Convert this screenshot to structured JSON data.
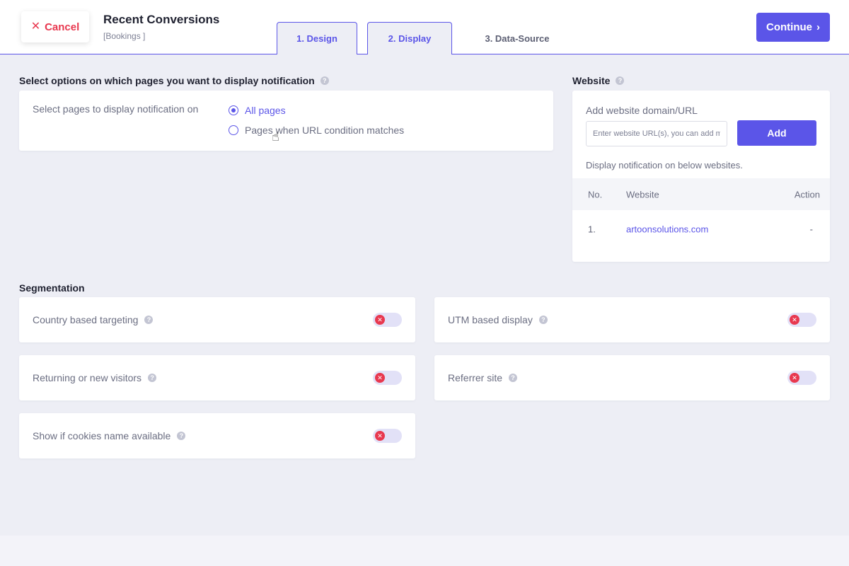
{
  "header": {
    "cancel_label": "Cancel",
    "title": "Recent Conversions",
    "subtitle": "[Bookings ]",
    "tabs": [
      {
        "label": "1. Design"
      },
      {
        "label": "2. Display"
      },
      {
        "label": "3. Data-Source"
      }
    ],
    "continue_label": "Continue",
    "accent_color": "#5b55e8",
    "cancel_color": "#e8384f"
  },
  "display_pages": {
    "heading": "Select options on which pages you want to display notification",
    "field_label": "Select pages to display notification on",
    "options": [
      {
        "label": "All pages",
        "selected": true
      },
      {
        "label": "Pages when URL condition matches",
        "selected": false
      }
    ]
  },
  "website": {
    "heading": "Website",
    "field_label": "Add website domain/URL",
    "input_placeholder": "Enter website URL(s), you can add multiple",
    "add_label": "Add",
    "note": "Display notification on below websites.",
    "columns": [
      "No.",
      "Website",
      "Action"
    ],
    "rows": [
      {
        "no": "1.",
        "website": "artoonsolutions.com",
        "action": "-"
      }
    ]
  },
  "segmentation": {
    "heading": "Segmentation",
    "items": [
      {
        "label": "Country based targeting",
        "enabled": false
      },
      {
        "label": "UTM based display",
        "enabled": false
      },
      {
        "label": "Returning or new visitors",
        "enabled": false
      },
      {
        "label": "Referrer site",
        "enabled": false
      },
      {
        "label": "Show if cookies name available",
        "enabled": false
      }
    ]
  }
}
